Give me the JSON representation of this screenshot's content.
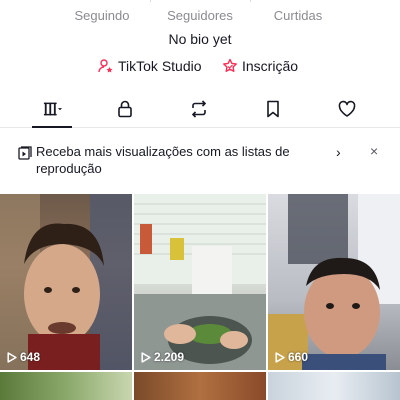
{
  "profile": {
    "stats": [
      {
        "value": "",
        "label": "Seguindo"
      },
      {
        "value": "",
        "label": "Seguidores"
      },
      {
        "value": "",
        "label": "Curtidas"
      }
    ],
    "bio": "No bio yet",
    "links": {
      "studio": "TikTok Studio",
      "inscricao": "Inscrição"
    }
  },
  "tabs": [
    {
      "icon": "grid-icon",
      "active": true
    },
    {
      "icon": "lock-icon",
      "active": false
    },
    {
      "icon": "repost-icon",
      "active": false
    },
    {
      "icon": "bookmark-icon",
      "active": false
    },
    {
      "icon": "heart-icon",
      "active": false
    }
  ],
  "banner": {
    "text": "Receba mais visualizações com as listas de reprodução",
    "chevron": "›",
    "close": "×"
  },
  "videos": [
    {
      "views": "648"
    },
    {
      "views": "2.209"
    },
    {
      "views": "660"
    },
    {
      "views": ""
    },
    {
      "views": ""
    },
    {
      "views": ""
    }
  ],
  "colors": {
    "text": "#161823",
    "muted": "#8a8b91",
    "accent": "#fe2c55"
  }
}
